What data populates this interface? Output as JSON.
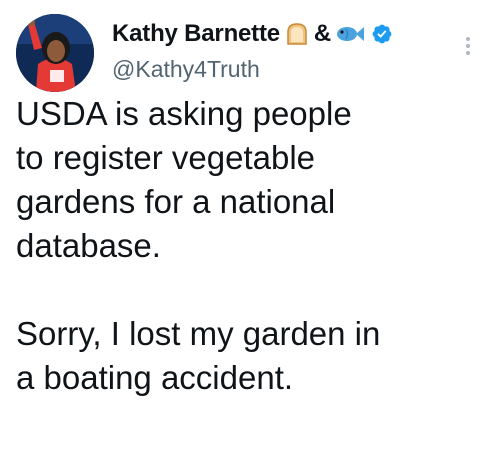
{
  "tweet": {
    "author_name": "Kathy Barnette",
    "name_amp": "&",
    "handle": "@Kathy4Truth",
    "emoji_names": [
      "bread-emoji",
      "fish-emoji"
    ],
    "verified_icon": "verified-badge-icon",
    "more_icon": "more-options-icon",
    "avatar_icon": "profile-avatar",
    "text_lines_p1": [
      "USDA is asking people",
      "to register vegetable",
      "gardens for a national",
      "database."
    ],
    "text_lines_p2": [
      "Sorry, I lost my garden in",
      "a boating accident."
    ]
  },
  "colors": {
    "verified": "#1d9bf0",
    "handle": "#536471",
    "text": "#0f1419"
  }
}
